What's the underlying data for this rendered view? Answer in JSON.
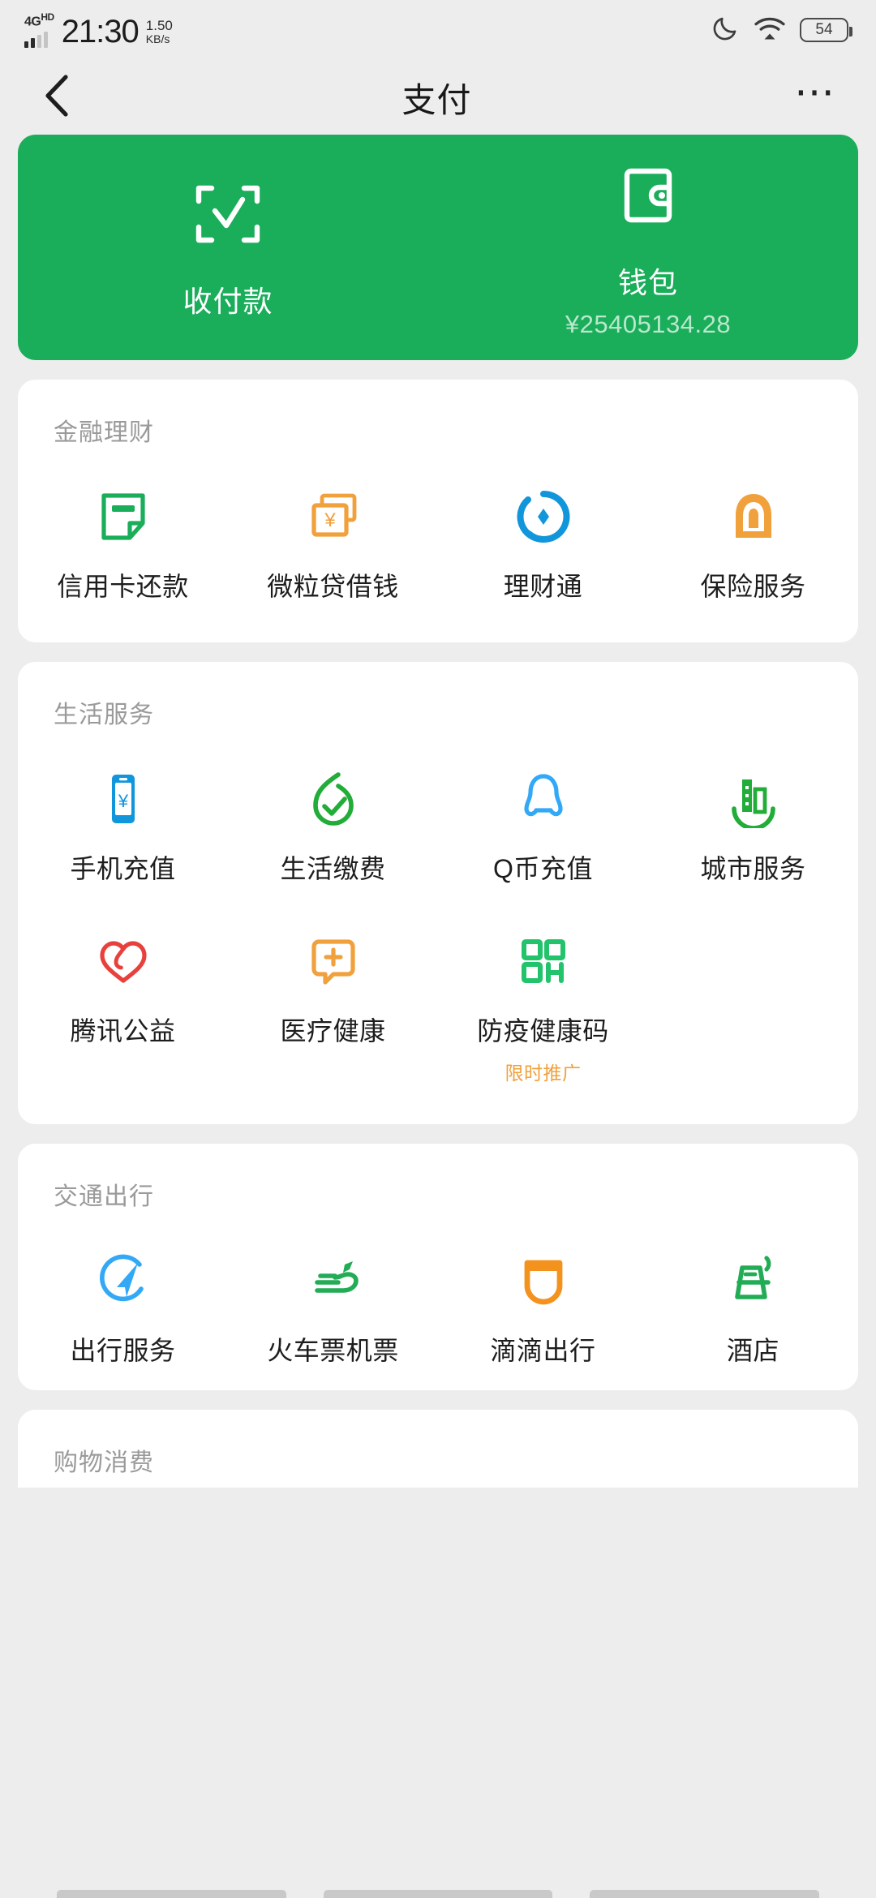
{
  "statusbar": {
    "network_type": "4G",
    "network_suffix": "HD",
    "time": "21:30",
    "speed_value": "1.50",
    "speed_unit": "KB/s",
    "moon_icon": "moon-icon",
    "wifi_icon": "wifi-icon",
    "battery_level": "54"
  },
  "navbar": {
    "back_icon": "chevron-left-icon",
    "title": "支付",
    "more_icon": "more-dots-icon"
  },
  "hero": {
    "background_color": "#1aad5a",
    "items": [
      {
        "icon": "scan-pay-icon",
        "label": "收付款",
        "sub": ""
      },
      {
        "icon": "wallet-icon",
        "label": "钱包",
        "sub": "¥25405134.28"
      }
    ]
  },
  "sections": [
    {
      "title": "金融理财",
      "items": [
        {
          "icon": "credit-card-repay-icon",
          "label": "信用卡还款",
          "color": "#1aad5a",
          "badge": ""
        },
        {
          "icon": "weilidai-loan-icon",
          "label": "微粒贷借钱",
          "color": "#f0a13c",
          "badge": ""
        },
        {
          "icon": "licaitong-icon",
          "label": "理财通",
          "color": "#1296db",
          "badge": ""
        },
        {
          "icon": "insurance-icon",
          "label": "保险服务",
          "color": "#f0a13c",
          "badge": ""
        }
      ]
    },
    {
      "title": "生活服务",
      "items": [
        {
          "icon": "mobile-topup-icon",
          "label": "手机充值",
          "color": "#1296db",
          "badge": ""
        },
        {
          "icon": "utility-payment-icon",
          "label": "生活缴费",
          "color": "#22ac38",
          "badge": ""
        },
        {
          "icon": "qcoin-topup-icon",
          "label": "Q币充值",
          "color": "#33a9f5",
          "badge": ""
        },
        {
          "icon": "city-service-icon",
          "label": "城市服务",
          "color": "#22ac38",
          "badge": ""
        },
        {
          "icon": "tencent-charity-icon",
          "label": "腾讯公益",
          "color": "#e8403c",
          "badge": ""
        },
        {
          "icon": "medical-health-icon",
          "label": "医疗健康",
          "color": "#f0a13c",
          "badge": ""
        },
        {
          "icon": "health-code-icon",
          "label": "防疫健康码",
          "color": "#22c36b",
          "badge": "限时推广"
        }
      ]
    },
    {
      "title": "交通出行",
      "items": [
        {
          "icon": "travel-service-icon",
          "label": "出行服务",
          "color": "#33a9f5",
          "badge": ""
        },
        {
          "icon": "train-flight-ticket-icon",
          "label": "火车票机票",
          "color": "#22ac55",
          "badge": ""
        },
        {
          "icon": "didi-ride-icon",
          "label": "滴滴出行",
          "color": "#f4921e",
          "badge": ""
        },
        {
          "icon": "hotel-icon",
          "label": "酒店",
          "color": "#22ac55",
          "badge": ""
        }
      ]
    },
    {
      "title": "购物消费",
      "items": []
    }
  ]
}
